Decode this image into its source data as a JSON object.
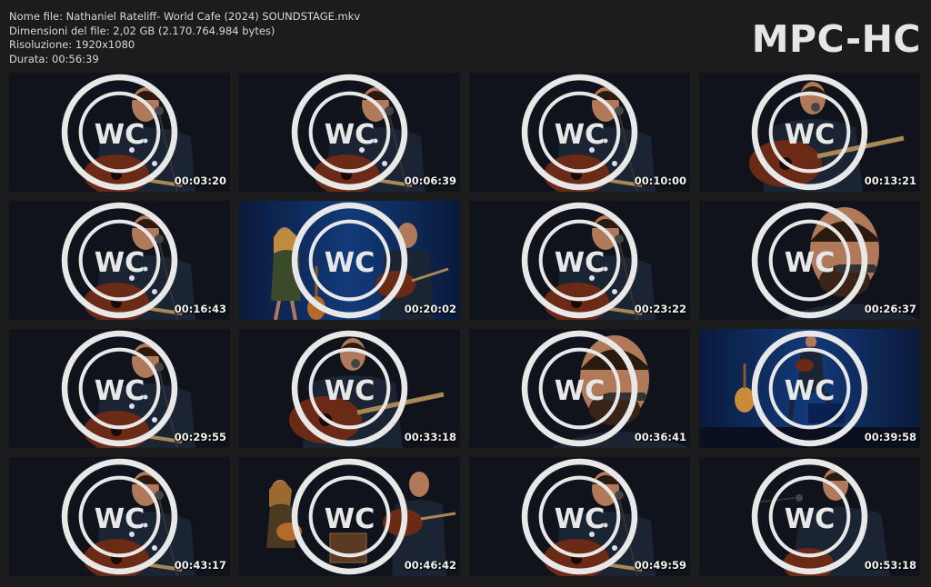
{
  "file_info": {
    "name_line": "Nome file: Nathaniel Rateliff- World Cafe (2024) SOUNDSTAGE.mkv",
    "size_line": "Dimensioni del file: 2,02 GB (2.170.764.984 bytes)",
    "resolution_line": "Risoluzione: 1920x1080",
    "duration_line": "Durata: 00:56:39"
  },
  "brand": "MPC-HC",
  "thumbnails": [
    {
      "time": "00:03:20",
      "scene": "closeup-guitar"
    },
    {
      "time": "00:06:39",
      "scene": "closeup-guitar"
    },
    {
      "time": "00:10:00",
      "scene": "closeup-guitar"
    },
    {
      "time": "00:13:21",
      "scene": "playing-guitar"
    },
    {
      "time": "00:16:43",
      "scene": "closeup-guitar"
    },
    {
      "time": "00:20:02",
      "scene": "duet-blue"
    },
    {
      "time": "00:23:22",
      "scene": "closeup-guitar"
    },
    {
      "time": "00:26:37",
      "scene": "face-closeup"
    },
    {
      "time": "00:29:55",
      "scene": "closeup-guitar"
    },
    {
      "time": "00:33:18",
      "scene": "playing-guitar"
    },
    {
      "time": "00:36:41",
      "scene": "face-closeup"
    },
    {
      "time": "00:39:58",
      "scene": "wide-stage"
    },
    {
      "time": "00:43:17",
      "scene": "closeup-guitar"
    },
    {
      "time": "00:46:42",
      "scene": "duet-dark"
    },
    {
      "time": "00:49:59",
      "scene": "closeup-guitar"
    },
    {
      "time": "00:53:18",
      "scene": "side-guitar"
    }
  ],
  "logo_icon": "world-cafe-logo-icon"
}
